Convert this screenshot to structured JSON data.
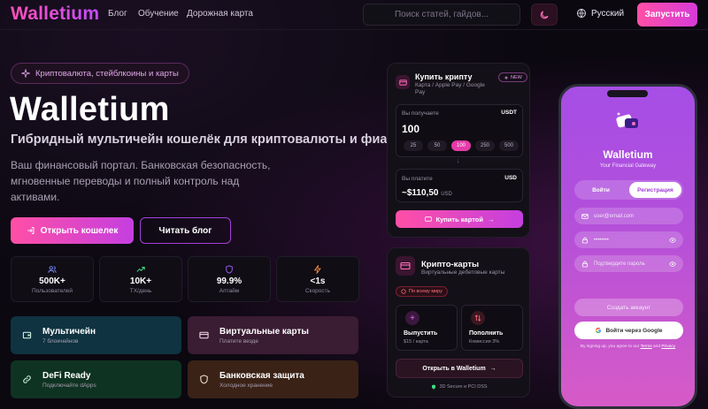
{
  "header": {
    "logo": "Walletium",
    "nav": [
      "Блог",
      "Обучение",
      "Дорожная карта"
    ],
    "search_placeholder": "Поиск статей, гайдов...",
    "language": "Русский",
    "cta": "Запустить"
  },
  "hero": {
    "badge": "Криптовалюта, стейблкоины и карты",
    "title": "Walletium",
    "subtitle": "Гибридный мультичейн кошелёк для криптовалюты и фиата",
    "description": "Ваш финансовый портал. Банковская безопасность, мгновенные переводы и полный контроль над активами.",
    "primary_button": "Открыть кошелек",
    "secondary_button": "Читать блог"
  },
  "stats": [
    {
      "value": "500K+",
      "label": "Пользователей",
      "icon": "users-icon"
    },
    {
      "value": "10K+",
      "label": "TX/день",
      "icon": "trend-up-icon"
    },
    {
      "value": "99.9%",
      "label": "Аптайм",
      "icon": "shield-icon"
    },
    {
      "value": "<1s",
      "label": "Скорость",
      "icon": "bolt-icon"
    }
  ],
  "features": [
    {
      "title": "Мультичейн",
      "subtitle": "7 блокчейнов",
      "icon": "wallet-icon",
      "bg": "#0f3340"
    },
    {
      "title": "Виртуальные карты",
      "subtitle": "Платите везде",
      "icon": "card-icon",
      "bg": "#3a1c33"
    },
    {
      "title": "DeFi Ready",
      "subtitle": "Подключайте dApps",
      "icon": "link-icon",
      "bg": "#0f3322"
    },
    {
      "title": "Банковская защита",
      "subtitle": "Холодное хранение",
      "icon": "shield-icon",
      "bg": "#3a2216"
    }
  ],
  "buy_card": {
    "title": "Купить крипту",
    "subtitle": "Карта / Apple Pay / Google Pay",
    "badge": "NEW",
    "receive_label": "Вы получаете",
    "receive_currency": "USDT",
    "receive_value": "100",
    "amounts": [
      "25",
      "50",
      "100",
      "250",
      "500"
    ],
    "active_amount": "100",
    "pay_label": "Вы платите",
    "pay_currency": "USD",
    "pay_value": "~$110,50",
    "pay_unit": "USD",
    "button": "Купить картой"
  },
  "crypto_card": {
    "title": "Крипто-карты",
    "subtitle": "Виртуальные дебетовые карты",
    "badge": "По всему миру",
    "actions": [
      {
        "title": "Выпустить",
        "subtitle": "$15 / карта",
        "icon": "plus-icon"
      },
      {
        "title": "Пополнить",
        "subtitle": "Комиссия 3%",
        "icon": "swap-icon"
      }
    ],
    "button": "Открыть в Walletium",
    "footer": "3D Secure и PCI DSS"
  },
  "phone": {
    "app_name": "Walletium",
    "tagline": "Your Financial Gateway",
    "tabs": [
      "Войти",
      "Регистрация"
    ],
    "active_tab": "Регистрация",
    "email_placeholder": "user@email.com",
    "password_placeholder": "••••••••",
    "confirm_placeholder": "Подтвердите пароль",
    "create_button": "Создать аккаунт",
    "google_button": "Войти через Google",
    "terms_prefix": "By signing up, you agree to our",
    "terms": "Terms",
    "and": "and",
    "privacy": "Privacy"
  },
  "colors": {
    "accent": "#ff4fa6",
    "accent2": "#c43fe0",
    "bg": "#0b0810"
  }
}
